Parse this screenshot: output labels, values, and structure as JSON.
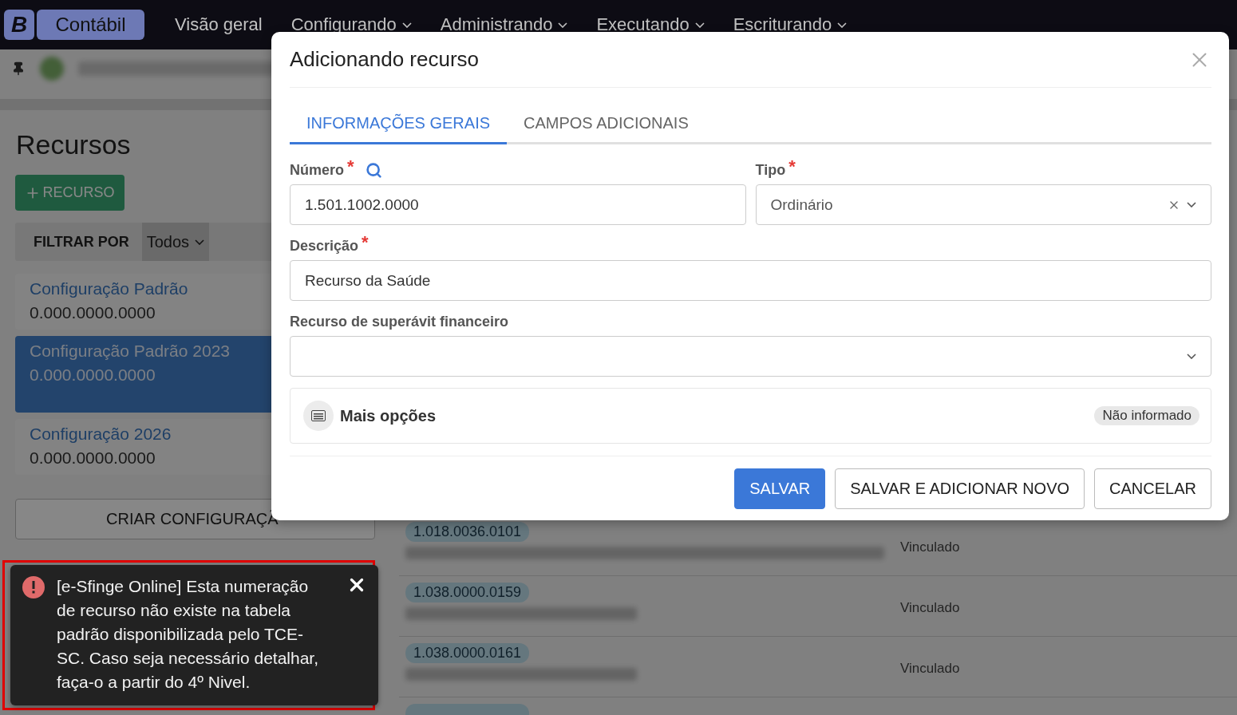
{
  "app_bar": {
    "logo": "B",
    "product": "Contábil",
    "menu": [
      {
        "label": "Visão geral",
        "dropdown": false
      },
      {
        "label": "Configurando",
        "dropdown": true
      },
      {
        "label": "Administrando",
        "dropdown": true
      },
      {
        "label": "Executando",
        "dropdown": true
      },
      {
        "label": "Escriturando",
        "dropdown": true
      }
    ]
  },
  "sidebar": {
    "title": "Recursos",
    "add_button": "RECURSO",
    "filter": {
      "label": "FILTRAR POR",
      "value": "Todos"
    },
    "configurations": [
      {
        "name": "Configuração Padrão",
        "code": "0.000.0000.0000",
        "selected": false
      },
      {
        "name": "Configuração Padrão 2023",
        "code": "0.000.0000.0000",
        "selected": true
      },
      {
        "name": "Configuração 2026",
        "code": "0.000.0000.0000",
        "selected": false
      }
    ],
    "create_button": "CRIAR CONFIGURAÇÃ"
  },
  "table": {
    "rows": [
      {
        "code": "1.018.0036.0101",
        "status": "Vinculado"
      },
      {
        "code": "1.038.0000.0159",
        "status": "Vinculado"
      },
      {
        "code": "1.038.0000.0161",
        "status": "Vinculado"
      }
    ]
  },
  "dialog": {
    "title": "Adicionando recurso",
    "tabs": [
      {
        "label": "INFORMAÇÕES GERAIS",
        "selected": true
      },
      {
        "label": "CAMPOS ADICIONAIS",
        "selected": false
      }
    ],
    "fields": [
      {
        "kind": "text",
        "label": "Número",
        "required_mark": "*",
        "search": true,
        "value": "1.501.1002.0000",
        "half": true
      },
      {
        "kind": "select",
        "label": "Tipo",
        "required_mark": "*",
        "clearable": true,
        "value": "Ordinário",
        "half": true
      },
      {
        "kind": "text",
        "label": "Descrição",
        "required_mark": "*",
        "search": false,
        "value": "Recurso da Saúde",
        "half": false
      },
      {
        "kind": "select",
        "label": "Recurso de superávit financeiro",
        "clearable": false,
        "half": false
      }
    ],
    "more_options": {
      "label": "Mais opções",
      "badge": "Não informado"
    },
    "buttons": [
      {
        "label": "SALVAR",
        "primary": true
      },
      {
        "label": "SALVAR E ADICIONAR NOVO",
        "primary": false
      },
      {
        "label": "CANCELAR",
        "primary": false
      }
    ]
  },
  "toast": {
    "kind": "error",
    "message": "[e-Sfinge Online] Esta numeração de recurso não existe na tabela padrão disponibilizada pelo TCE-SC. Caso seja necessário detalhar, faça-o a partir do 4º Nivel."
  }
}
